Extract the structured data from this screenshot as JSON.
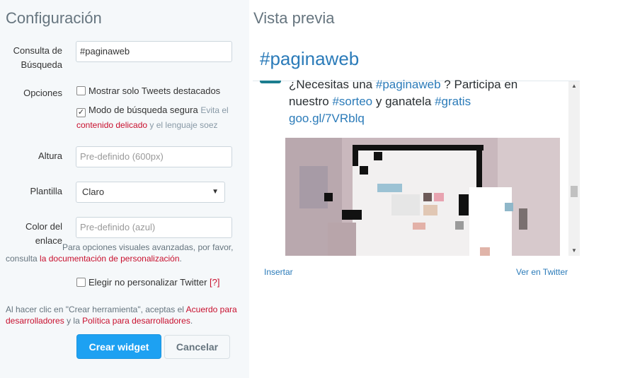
{
  "config": {
    "title": "Configuración",
    "search_label_line1": "Consulta de",
    "search_label_line2": "Búsqueda",
    "search_value": "#paginaweb",
    "options_label": "Opciones",
    "option1_label": "Mostrar solo Tweets destacados",
    "option2_label": "Modo de búsqueda segura",
    "option2_help_prefix": "Evita el",
    "option2_help_link": "contenido delicado",
    "option2_help_suffix": "y el lenguaje soez",
    "height_label": "Altura",
    "height_placeholder": "Pre-definido (600px)",
    "template_label": "Plantilla",
    "template_value": "Claro",
    "link_color_label_line1": "Color del",
    "link_color_label_line2": "enlace",
    "link_color_placeholder": "Pre-definido (azul)",
    "advanced_help_line1": "Para opciones visuales avanzadas, por favor,",
    "advanced_help_prefix": "consulta",
    "advanced_help_link": "la documentación de personalización",
    "advanced_help_suffix": ".",
    "no_personalize_label": "Elegir no personalizar Twitter",
    "no_personalize_help": "[?]",
    "terms_prefix": "Al hacer clic en \"Crear herramienta\", aceptas el",
    "terms_link1_part1": "Acuerdo para",
    "terms_link1_part2": "desarrolladores",
    "terms_mid": "y la",
    "terms_link2": "Política para desarrolladores",
    "terms_suffix": ".",
    "create_button": "Crear widget",
    "cancel_button": "Cancelar"
  },
  "preview": {
    "title": "Vista previa",
    "hashtag": "#paginaweb",
    "tweet_line1_prefix": "¿Necesitas una",
    "tweet_line1_link": "#paginaweb",
    "tweet_line1_suffix": "? Participa en",
    "tweet_line2_prefix": "nuestro",
    "tweet_line2_link1": "#sorteo",
    "tweet_line2_mid": "y ganatela",
    "tweet_line2_link2": "#gratis",
    "tweet_line3_link": "goo.gl/7VRblq",
    "insert_link": "Insertar",
    "view_link": "Ver en Twitter"
  },
  "colors": {
    "accent": "#1da1f2",
    "link": "#2b7bb9",
    "danger_link": "#c8102e",
    "panel_bg": "#f5f8fa"
  },
  "icons": [
    "checkbox-icon",
    "chevron-down-icon",
    "scroll-up-icon",
    "scroll-down-icon"
  ]
}
